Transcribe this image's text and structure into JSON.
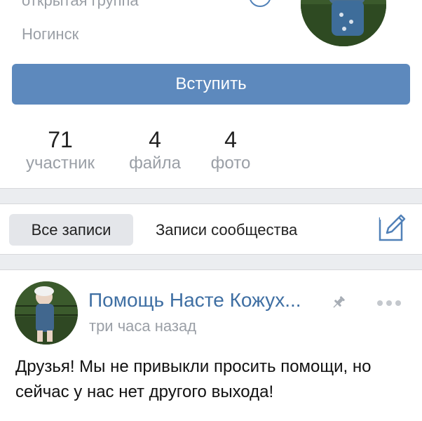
{
  "group": {
    "type_label": "открытая группа",
    "city": "Ногинск"
  },
  "join_button": {
    "label": "Вступить"
  },
  "counters": [
    {
      "value": "71",
      "label": "участник"
    },
    {
      "value": "4",
      "label": "файла"
    },
    {
      "value": "4",
      "label": "фото"
    }
  ],
  "filter": {
    "all_posts": "Все записи",
    "community_posts": "Записи сообщества"
  },
  "post": {
    "author": "Помощь Насте Кожух...",
    "time": "три часа назад",
    "text": "Друзья! Мы не привыкли просить помощи, но сейчас у нас нет другого выхода!"
  },
  "colors": {
    "accent": "#5d89bd",
    "link": "#3f6fa3",
    "muted": "#9a9fa6",
    "separator": "#ebedf0"
  },
  "icons": [
    "info-icon",
    "edit-post-icon",
    "pin-icon",
    "more-dots-icon"
  ]
}
